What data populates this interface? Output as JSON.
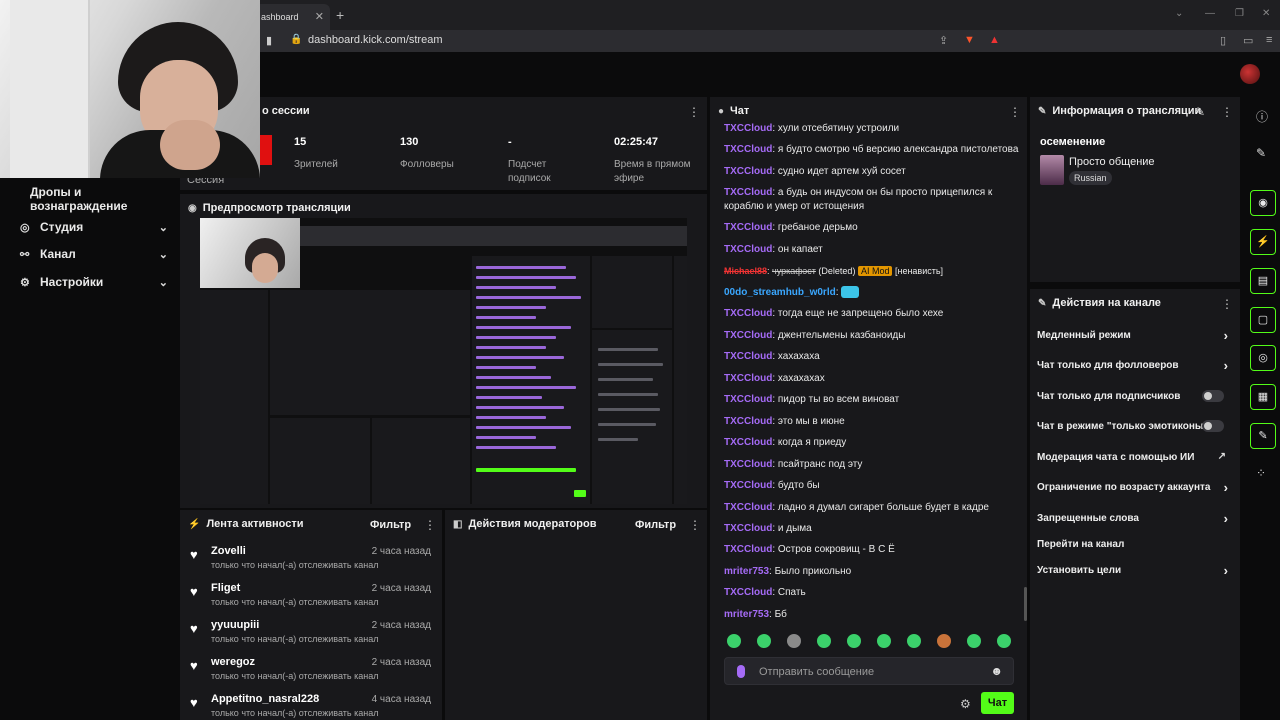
{
  "browser": {
    "tab_title": "ashboard",
    "tab_close": "✕",
    "new_tab": "+",
    "url": "dashboard.kick.com/stream"
  },
  "sidebar": {
    "session_label": "Сессия",
    "items": [
      {
        "label": "Дропы и вознаграждение",
        "icon": "gift-icon"
      },
      {
        "label": "Студия",
        "icon": "studio-icon",
        "chevron": "⌄"
      },
      {
        "label": "Канал",
        "icon": "channel-icon",
        "chevron": "⌄"
      },
      {
        "label": "Настройки",
        "icon": "settings-icon",
        "chevron": "⌄"
      }
    ]
  },
  "session": {
    "title": "о сессии",
    "stats": [
      {
        "value": "15",
        "label": "Зрителей"
      },
      {
        "value": "130",
        "label": "Фолловеры"
      },
      {
        "value": "-",
        "label": "Подсчет подписок"
      },
      {
        "value": "02:25:47",
        "label": "Время в прямом эфире"
      }
    ]
  },
  "preview": {
    "title": "Предпросмотр трансляции"
  },
  "activity": {
    "title": "Лента активности",
    "filter": "Фильтр",
    "items": [
      {
        "name": "Zovelli",
        "time": "2 часа назад",
        "desc": "только что начал(-а) отслеживать канал"
      },
      {
        "name": "Fliget",
        "time": "2 часа назад",
        "desc": "только что начал(-а) отслеживать канал"
      },
      {
        "name": "yyuuupiii",
        "time": "2 часа назад",
        "desc": "только что начал(-а) отслеживать канал"
      },
      {
        "name": "weregoz",
        "time": "2 часа назад",
        "desc": "только что начал(-а) отслеживать канал"
      },
      {
        "name": "Appetitno_nasral228",
        "time": "4 часа назад",
        "desc": "только что начал(-а) отслеживать канал"
      }
    ]
  },
  "moderators": {
    "title": "Действия модераторов",
    "filter": "Фильтр"
  },
  "chat": {
    "title": "Чат",
    "messages": [
      {
        "user": "TXCCloud",
        "text": "хули отсебятину устроили"
      },
      {
        "user": "TXCCloud",
        "text": "я будто смотрю чб версию александра пистолетова"
      },
      {
        "user": "TXCCloud",
        "text": "судно идет артем хуй сосет"
      },
      {
        "user": "TXCCloud",
        "text": "а будь он индусом он бы просто прицепился к кораблю и умер от истощения"
      },
      {
        "user": "TXCCloud",
        "text": "гребаное дерьмо"
      },
      {
        "user": "TXCCloud",
        "text": "он капает"
      },
      {
        "user": "Michael88",
        "text": "чуркафэст",
        "deleted": "(Deleted)",
        "badge": "AI Mod",
        "tag": "[ненависть]"
      },
      {
        "user": "00do_streamhub_w0rld",
        "text": ""
      },
      {
        "user": "TXCCloud",
        "text": "тогда еще не запрещено было хехе"
      },
      {
        "user": "TXCCloud",
        "text": "джентельмены казбаноиды"
      },
      {
        "user": "TXCCloud",
        "text": "хахахаха"
      },
      {
        "user": "TXCCloud",
        "text": "хахахахах"
      },
      {
        "user": "TXCCloud",
        "text": "пидор ты во всем виноват"
      },
      {
        "user": "TXCCloud",
        "text": "это мы в июне"
      },
      {
        "user": "TXCCloud",
        "text": "когда я приеду"
      },
      {
        "user": "TXCCloud",
        "text": "псайтранс под эту"
      },
      {
        "user": "TXCCloud",
        "text": "будто бы"
      },
      {
        "user": "TXCCloud",
        "text": "ладно я думал сигарет больше будет в кадре"
      },
      {
        "user": "TXCCloud",
        "text": "и дыма"
      },
      {
        "user": "TXCCloud",
        "text": "Остров сокровищ - В С Ё"
      },
      {
        "user": "mriter753",
        "text": "Было прикольно"
      },
      {
        "user": "TXCCloud",
        "text": "Спать"
      },
      {
        "user": "mriter753",
        "text": "Бб"
      }
    ],
    "input_placeholder": "Отправить сообщение",
    "send_label": "Чат"
  },
  "stream_info": {
    "title": "Информация о трансляции",
    "stream_title": "осеменение",
    "category": "Просто общение",
    "language": "Russian"
  },
  "channel_actions": {
    "title": "Действия на канале",
    "items": [
      {
        "label": "Медленный режим",
        "control": "chevron"
      },
      {
        "label": "Чат только для фолловеров",
        "control": "chevron"
      },
      {
        "label": "Чат только для подписчиков",
        "control": "toggle"
      },
      {
        "label": "Чат в режиме \"только эмотиконы\"",
        "control": "toggle"
      },
      {
        "label": "Модерация чата с помощью ИИ",
        "control": "external"
      },
      {
        "label": "Ограничение по возрасту аккаунта",
        "control": "chevron"
      },
      {
        "label": "Запрещенные слова",
        "control": "chevron"
      },
      {
        "label": "Перейти на канал",
        "control": "none"
      },
      {
        "label": "Установить цели",
        "control": "chevron"
      }
    ]
  },
  "colors": {
    "accent": "#53fc18",
    "username": "#a56bf6",
    "panel": "#18181b",
    "background": "#0b0b0c"
  }
}
